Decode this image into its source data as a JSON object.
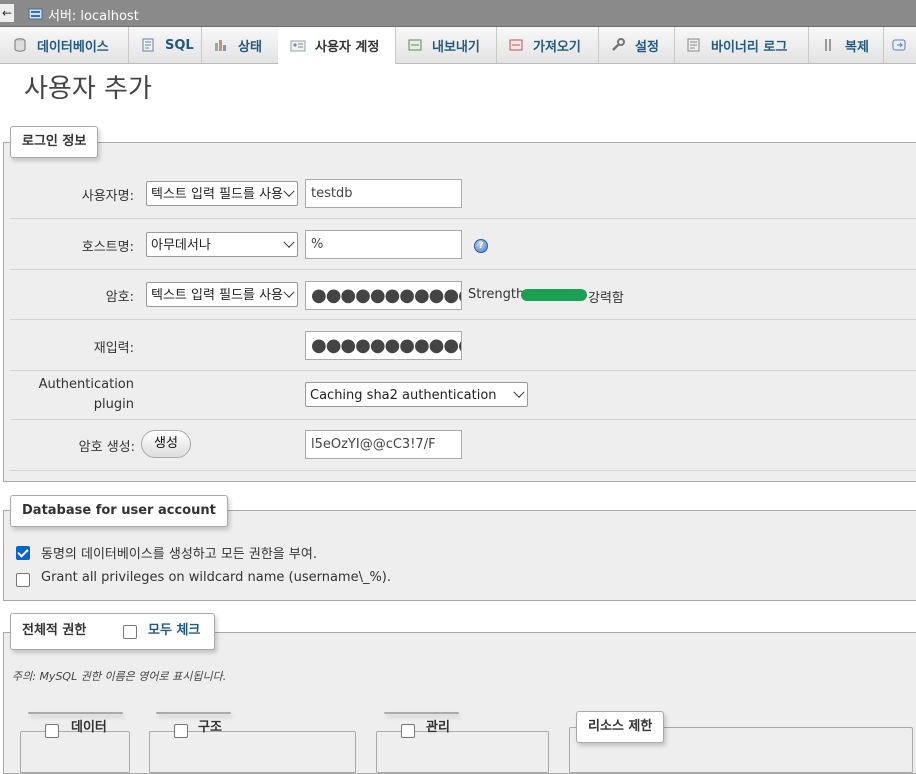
{
  "server_bar": {
    "back_arrow": "←",
    "label": "서버: localhost"
  },
  "tabs": [
    {
      "label": "데이터베이스",
      "icon": "database-icon"
    },
    {
      "label": "SQL",
      "icon": "sql-icon"
    },
    {
      "label": "상태",
      "icon": "status-icon"
    },
    {
      "label": "사용자 계정",
      "icon": "users-icon",
      "active": true
    },
    {
      "label": "내보내기",
      "icon": "export-icon"
    },
    {
      "label": "가져오기",
      "icon": "import-icon"
    },
    {
      "label": "설정",
      "icon": "wrench-icon"
    },
    {
      "label": "바이너리 로그",
      "icon": "binlog-icon"
    },
    {
      "label": "복제",
      "icon": "replication-icon"
    }
  ],
  "page_title": "사용자 추가",
  "login": {
    "legend": "로그인 정보",
    "username": {
      "label": "사용자명:",
      "select": "텍스트 입력 필드를 사용",
      "value": "testdb"
    },
    "hostname": {
      "label": "호스트명:",
      "select": "아무데서나",
      "value": "%",
      "help_icon": "?"
    },
    "password": {
      "label": "암호:",
      "select": "텍스트 입력 필드를 사용",
      "value": "●●●●●●●●●●●●",
      "strength_label": "Strength:",
      "strength_value": "강력함",
      "strength_color": "#1aa052"
    },
    "retype": {
      "label": "재입력:",
      "value": "●●●●●●●●●●●●"
    },
    "auth": {
      "label_line1": "Authentication",
      "label_line2": "plugin",
      "select": "Caching sha2 authentication"
    },
    "generate": {
      "label": "암호 생성:",
      "button": "생성",
      "value": "l5eOzYI@@cC3!7/F"
    }
  },
  "database": {
    "legend": "Database for user account",
    "options": [
      {
        "label": "동명의 데이터베이스를 생성하고 모든 권한을 부여.",
        "checked": true
      },
      {
        "label": "Grant all privileges on wildcard name (username\\_%).",
        "checked": false
      }
    ]
  },
  "global_privileges": {
    "legend": "전체적 권한",
    "check_all": "모두 체크",
    "note": "주의: MySQL 권한 이름은 영어로 표시됩니다.",
    "groups": [
      "데이터",
      "구조",
      "관리"
    ],
    "resource_limits": "리소스 제한"
  },
  "colors": {
    "link": "#235a81",
    "accent": "#0b63c9"
  }
}
